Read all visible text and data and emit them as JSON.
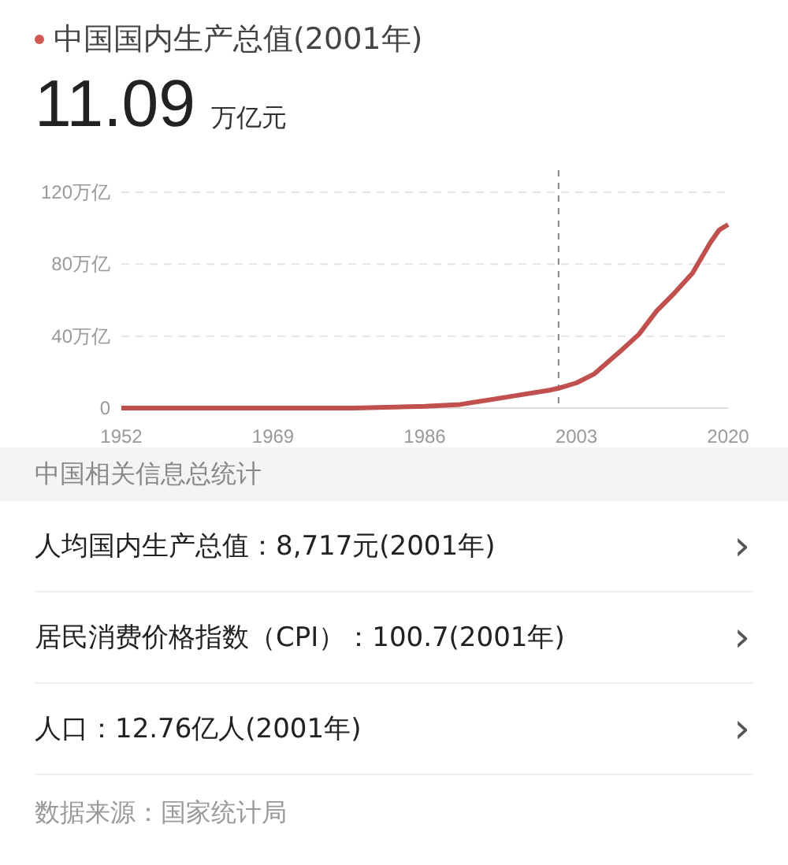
{
  "header": {
    "title": "中国国内生产总值(2001年)",
    "value": "11.09",
    "unit": "万亿元"
  },
  "chart_data": {
    "type": "line",
    "x": [
      1952,
      1960,
      1970,
      1978,
      1986,
      1990,
      1995,
      2000,
      2001,
      2003,
      2005,
      2008,
      2010,
      2012,
      2014,
      2016,
      2018,
      2019,
      2020
    ],
    "series": [
      {
        "color": "#c0504d",
        "values": [
          0,
          0,
          0,
          0,
          1,
          2,
          6,
          10,
          11,
          14,
          19,
          32,
          41,
          54,
          64,
          75,
          92,
          99,
          102
        ]
      }
    ],
    "xlim": [
      1952,
      2020
    ],
    "ylim": [
      0,
      120
    ],
    "xticks": [
      1952,
      1969,
      1986,
      2003,
      2020
    ],
    "yticks": [
      {
        "value": 0,
        "label": "0"
      },
      {
        "value": 40,
        "label": "40万亿"
      },
      {
        "value": 80,
        "label": "80万亿"
      },
      {
        "value": 120,
        "label": "120万亿"
      }
    ],
    "ref_lines": [
      {
        "axis": "x",
        "value": 2001
      }
    ]
  },
  "section_title": "中国相关信息总统计",
  "items": [
    {
      "text": "人均国内生产总值：8,717元(2001年)",
      "chevron": "›"
    },
    {
      "text": "居民消费价格指数（CPI）：100.7(2001年)",
      "chevron": "›"
    },
    {
      "text": "人口：12.76亿人(2001年)",
      "chevron": "›"
    }
  ],
  "source": "数据来源：国家统计局"
}
